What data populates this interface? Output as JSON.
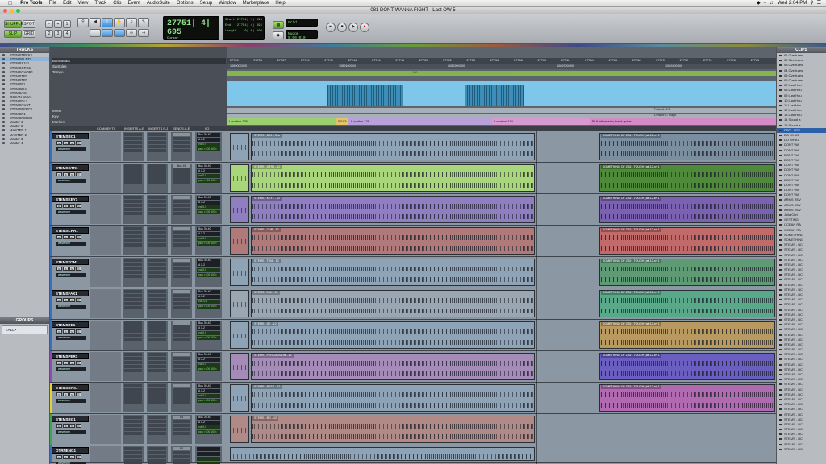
{
  "menubar": {
    "apple": "",
    "items": [
      "Pro Tools",
      "File",
      "Edit",
      "View",
      "Track",
      "Clip",
      "Event",
      "AudioSuite",
      "Options",
      "Setup",
      "Window",
      "Marketplace",
      "Help"
    ],
    "clock": "Wed 2:04 PM"
  },
  "window": {
    "title": "081 DONT WANNA FIGHT - Last OW 5"
  },
  "toolbar": {
    "main_counter": "27751| 4| 695",
    "sub_label": "Cursor",
    "start_label": "Start",
    "end_label": "End",
    "length_label": "Length",
    "start": "27751| 4| 695",
    "end": "27751| 4| 695",
    "length": "0| 0| 000",
    "pre": "0| 0| 000",
    "post": "0| 0| 000",
    "grid": "Grid",
    "nudge": "Nudge",
    "nudge_value": "0:00.010",
    "mode_shuffle": "SHUFFLE",
    "mode_spot": "SPOT",
    "mode_slip": "SLIP",
    "mode_grid": "GRID"
  },
  "tracks_panel": {
    "title": "TRACKS",
    "items": [
      "STEMSTRCK1",
      "STEMSBLND1",
      "STEMSS1L1",
      "STEMSORC1",
      "STEMSCHOR1",
      "STEMSTP1",
      "STEMSTP1",
      "STEMSF1",
      "STEMSBK1",
      "STEMSAS1",
      "OCEAN WAV1",
      "STEMSDL2",
      "STEMSCHAT1",
      "STEMSPERC1",
      "STEMSP1",
      "STEMSPERC2",
      "Master 1",
      "Master 2",
      "MASTER 1",
      "MASTER 2",
      "Master 3",
      "Master 4"
    ]
  },
  "groups_panel": {
    "title": "GROUPS",
    "items": [
      "<ALL>"
    ]
  },
  "rulers": {
    "labels": [
      "Bars|Beats",
      "Samples",
      "Tempo",
      "Meter",
      "Key",
      "Markers"
    ],
    "bars": [
      "27728",
      "27733",
      "27737",
      "27740",
      "27742",
      "27744",
      "27746",
      "27748",
      "27750",
      "27752",
      "27753",
      "27756",
      "27758",
      "27760",
      "27762",
      "27764",
      "27766",
      "27768",
      "27770",
      "27772",
      "27776",
      "27778",
      "27780"
    ],
    "samples": [
      "1089000000",
      "1089100000",
      "1089200000",
      "1089300000",
      "1089400000"
    ],
    "tempo_value": "100",
    "meter_value": "Default: 4/4",
    "key_value": "Default: C major",
    "markers": [
      "Location 126",
      "S/103",
      "Location 128",
      "Location 134",
      "BLK alt version, back guitar"
    ]
  },
  "columns": [
    "COMMENTS",
    "INSERTS A-E",
    "INSERTS F-J",
    "SENDS A-E",
    "I/O"
  ],
  "tracks": [
    {
      "name": "STEMSBC1",
      "color": "#3c6fc2",
      "view": "waveform",
      "io_in": "Bus 39-40",
      "io_out": "A 1-2",
      "vol": "vol",
      "vol_val": "0.0",
      "pan": "pan",
      "pan_val": ">100 100<",
      "clip1": "STEMS - BC1 - 32a",
      "clip2": "SOMETHING OF ZA5 - TOUGH (alt-12 a+ 1",
      "send": ""
    },
    {
      "name": "STEMSGTR1",
      "color": "#3c6fc2",
      "view": "waveform",
      "io_in": "Bus 39-40",
      "io_out": "A 1-2",
      "vol": "vol",
      "vol_val": "0.0",
      "pan": "pan",
      "pan_val": ">100 100<",
      "clip1": "STEMS - GTR1 - 12",
      "clip2": "SOMETHING OF ZA5 - TOUGH (alt-12 a+ 1",
      "send": "Bus 15"
    },
    {
      "name": "STEMSKEY1",
      "color": "#3c6fc2",
      "view": "waveform",
      "io_in": "Bus 39-40",
      "io_out": "A 1-2",
      "vol": "vol",
      "vol_val": "0.0",
      "pan": "pan",
      "pan_val": ">100 100<",
      "clip1": "STEMS - KEY1 - 12",
      "clip2": "SOMETHING OF ZA5 - TOUGH (alt-12 a+ 1",
      "send": ""
    },
    {
      "name": "STEMSCHR1",
      "color": "#3c6fc2",
      "view": "waveform",
      "io_in": "Bus 39-40",
      "io_out": "A 1-2",
      "vol": "vol",
      "vol_val": "0.0",
      "pan": "pan",
      "pan_val": ">100 100<",
      "clip1": "STEMS - CHR - 12",
      "clip2": "SOMETHING OF ZA5 - TOUGH (alt-12 a+ 1",
      "send": ""
    },
    {
      "name": "STEMSTOM1",
      "color": "#3c6fc2",
      "view": "waveform",
      "io_in": "Bus 39-40",
      "io_out": "A 1-2",
      "vol": "vol",
      "vol_val": "0.0",
      "pan": "pan",
      "pan_val": ">100 100<",
      "clip1": "STEMS - TOM - 12",
      "clip2": "SOMETHING OF ZA5 - TOUGH (alt-12 a+ 1",
      "send": ""
    },
    {
      "name": "STEMSFAX1",
      "color": "#3c6fc2",
      "view": "waveform",
      "io_in": "Bus 39-40",
      "io_out": "A 1-2",
      "vol": "vol",
      "vol_val": "-0.1",
      "pan": "pan",
      "pan_val": ">100 100<",
      "clip1": "STEMS - FAX - 12",
      "clip2": "SOMETHING OF ZA5 - TOUGH (alt-12 a+ 1",
      "send": ""
    },
    {
      "name": "STEMSDE1",
      "color": "#3c6fc2",
      "view": "waveform",
      "io_in": "Bus 39-40",
      "io_out": "A 1-2",
      "vol": "vol",
      "vol_val": "0.0",
      "pan": "pan",
      "pan_val": ">100 100<",
      "clip1": "STEMS - DE - 12",
      "clip2": "SOMETHING OF ZA5 - TOUGH (alt-12 a+ 1",
      "send": ""
    },
    {
      "name": "STEMSPER1",
      "color": "#8c4fb0",
      "view": "waveform",
      "io_in": "Bus 39-40",
      "io_out": "A 1-2",
      "vol": "vol",
      "vol_val": "0.0",
      "pan": "pan",
      "pan_val": ">100 100<",
      "clip1": "STEMS - PERCUSSION - 12",
      "clip2": "SOMETHING OF ZA5 - TOUGH (alt-12 a+ 1",
      "send": ""
    },
    {
      "name": "STEMSBAS1",
      "color": "#e0d23a",
      "view": "waveform",
      "io_in": "Bus 39-40",
      "io_out": "A 1-2",
      "vol": "vol",
      "vol_val": "0.0",
      "pan": "pan",
      "pan_val": ">100 100<",
      "clip1": "STEMS - BASS - 12",
      "clip2": "SOMETHING OF ZA5 - TOUGH (alt-12 a+ 1",
      "send": ""
    },
    {
      "name": "STEMSBG1",
      "color": "#3fa35a",
      "view": "waveform",
      "io_in": "Bus 39-40",
      "io_out": "A 1-2",
      "vol": "vol",
      "vol_val": "0.0",
      "pan": "pan",
      "pan_val": ">100 100<",
      "clip1": "STEMS - BG - 12",
      "clip2": "",
      "send": "D4"
    },
    {
      "name": "OTRNENG1",
      "color": "#3c6fc2",
      "view": "waveform",
      "io_in": "",
      "io_out": "",
      "vol": "",
      "vol_val": "",
      "pan": "",
      "pan_val": "",
      "clip1": "",
      "clip2": "",
      "send": "F5"
    }
  ],
  "clips_panel": {
    "title": "CLIPS",
    "items": [
      "01 Overtures",
      "02 Overtures",
      "03 Overtures",
      "04 Overtures",
      "05 Overtures",
      "06 Overtures",
      "07 Last Hou",
      "08 Last Hou",
      "09 Last Hou",
      "10 Last Hou",
      "11 Last Hou",
      "12 Last Hou",
      "13 Last Hou",
      "14 Sound a",
      "15 Sound a",
      "DSO - VTS",
      "DO WHAT",
      "DO WHAT",
      "DONT WA",
      "DONT WA",
      "DONT WA",
      "DONT WA",
      "DONT WA",
      "DONT WA",
      "DONT WA",
      "DONT WA",
      "DONT WA",
      "DONT WA",
      "DONT WA",
      "ARMS REV",
      "ARMS REV",
      "ARMS REV",
      "Julia Chri",
      "GETTING",
      "OCEAN RA",
      "OCEAN RA",
      "SOMETHING",
      "SOMETHING",
      "STEMS - BC",
      "STEMS - BC",
      "STEMS - BC",
      "STEMS - BC",
      "STEMS - BC",
      "STEMS - BC",
      "STEMS - BC",
      "STEMS - BC",
      "STEMS - BC",
      "STEMS - BC",
      "STEMS - BC",
      "STEMS - BC",
      "STEMS - BC",
      "STEMS - BC",
      "STEMS - BC",
      "STEMS - BC",
      "STEMS - BC",
      "STEMS - BC",
      "STEMS - BC",
      "STEMS - BC",
      "STEMS - BC",
      "STEMS - BC",
      "STEMS - BC",
      "STEMS - BC",
      "STEMS - BC",
      "STEMS - BC",
      "STEMS - BC",
      "STEMS - BC",
      "STEMS - BC",
      "STEMS - BC",
      "STEMS - BC",
      "STEMS - BC",
      "STEMS - BC",
      "STEMS - BC",
      "STEMS - BC",
      "STEMS - BC",
      "STEMS - BC",
      "STEMS - BC",
      "STEMS - BC",
      "STEMS - BC",
      "STEMS - BC",
      "STEMS - BC"
    ]
  }
}
